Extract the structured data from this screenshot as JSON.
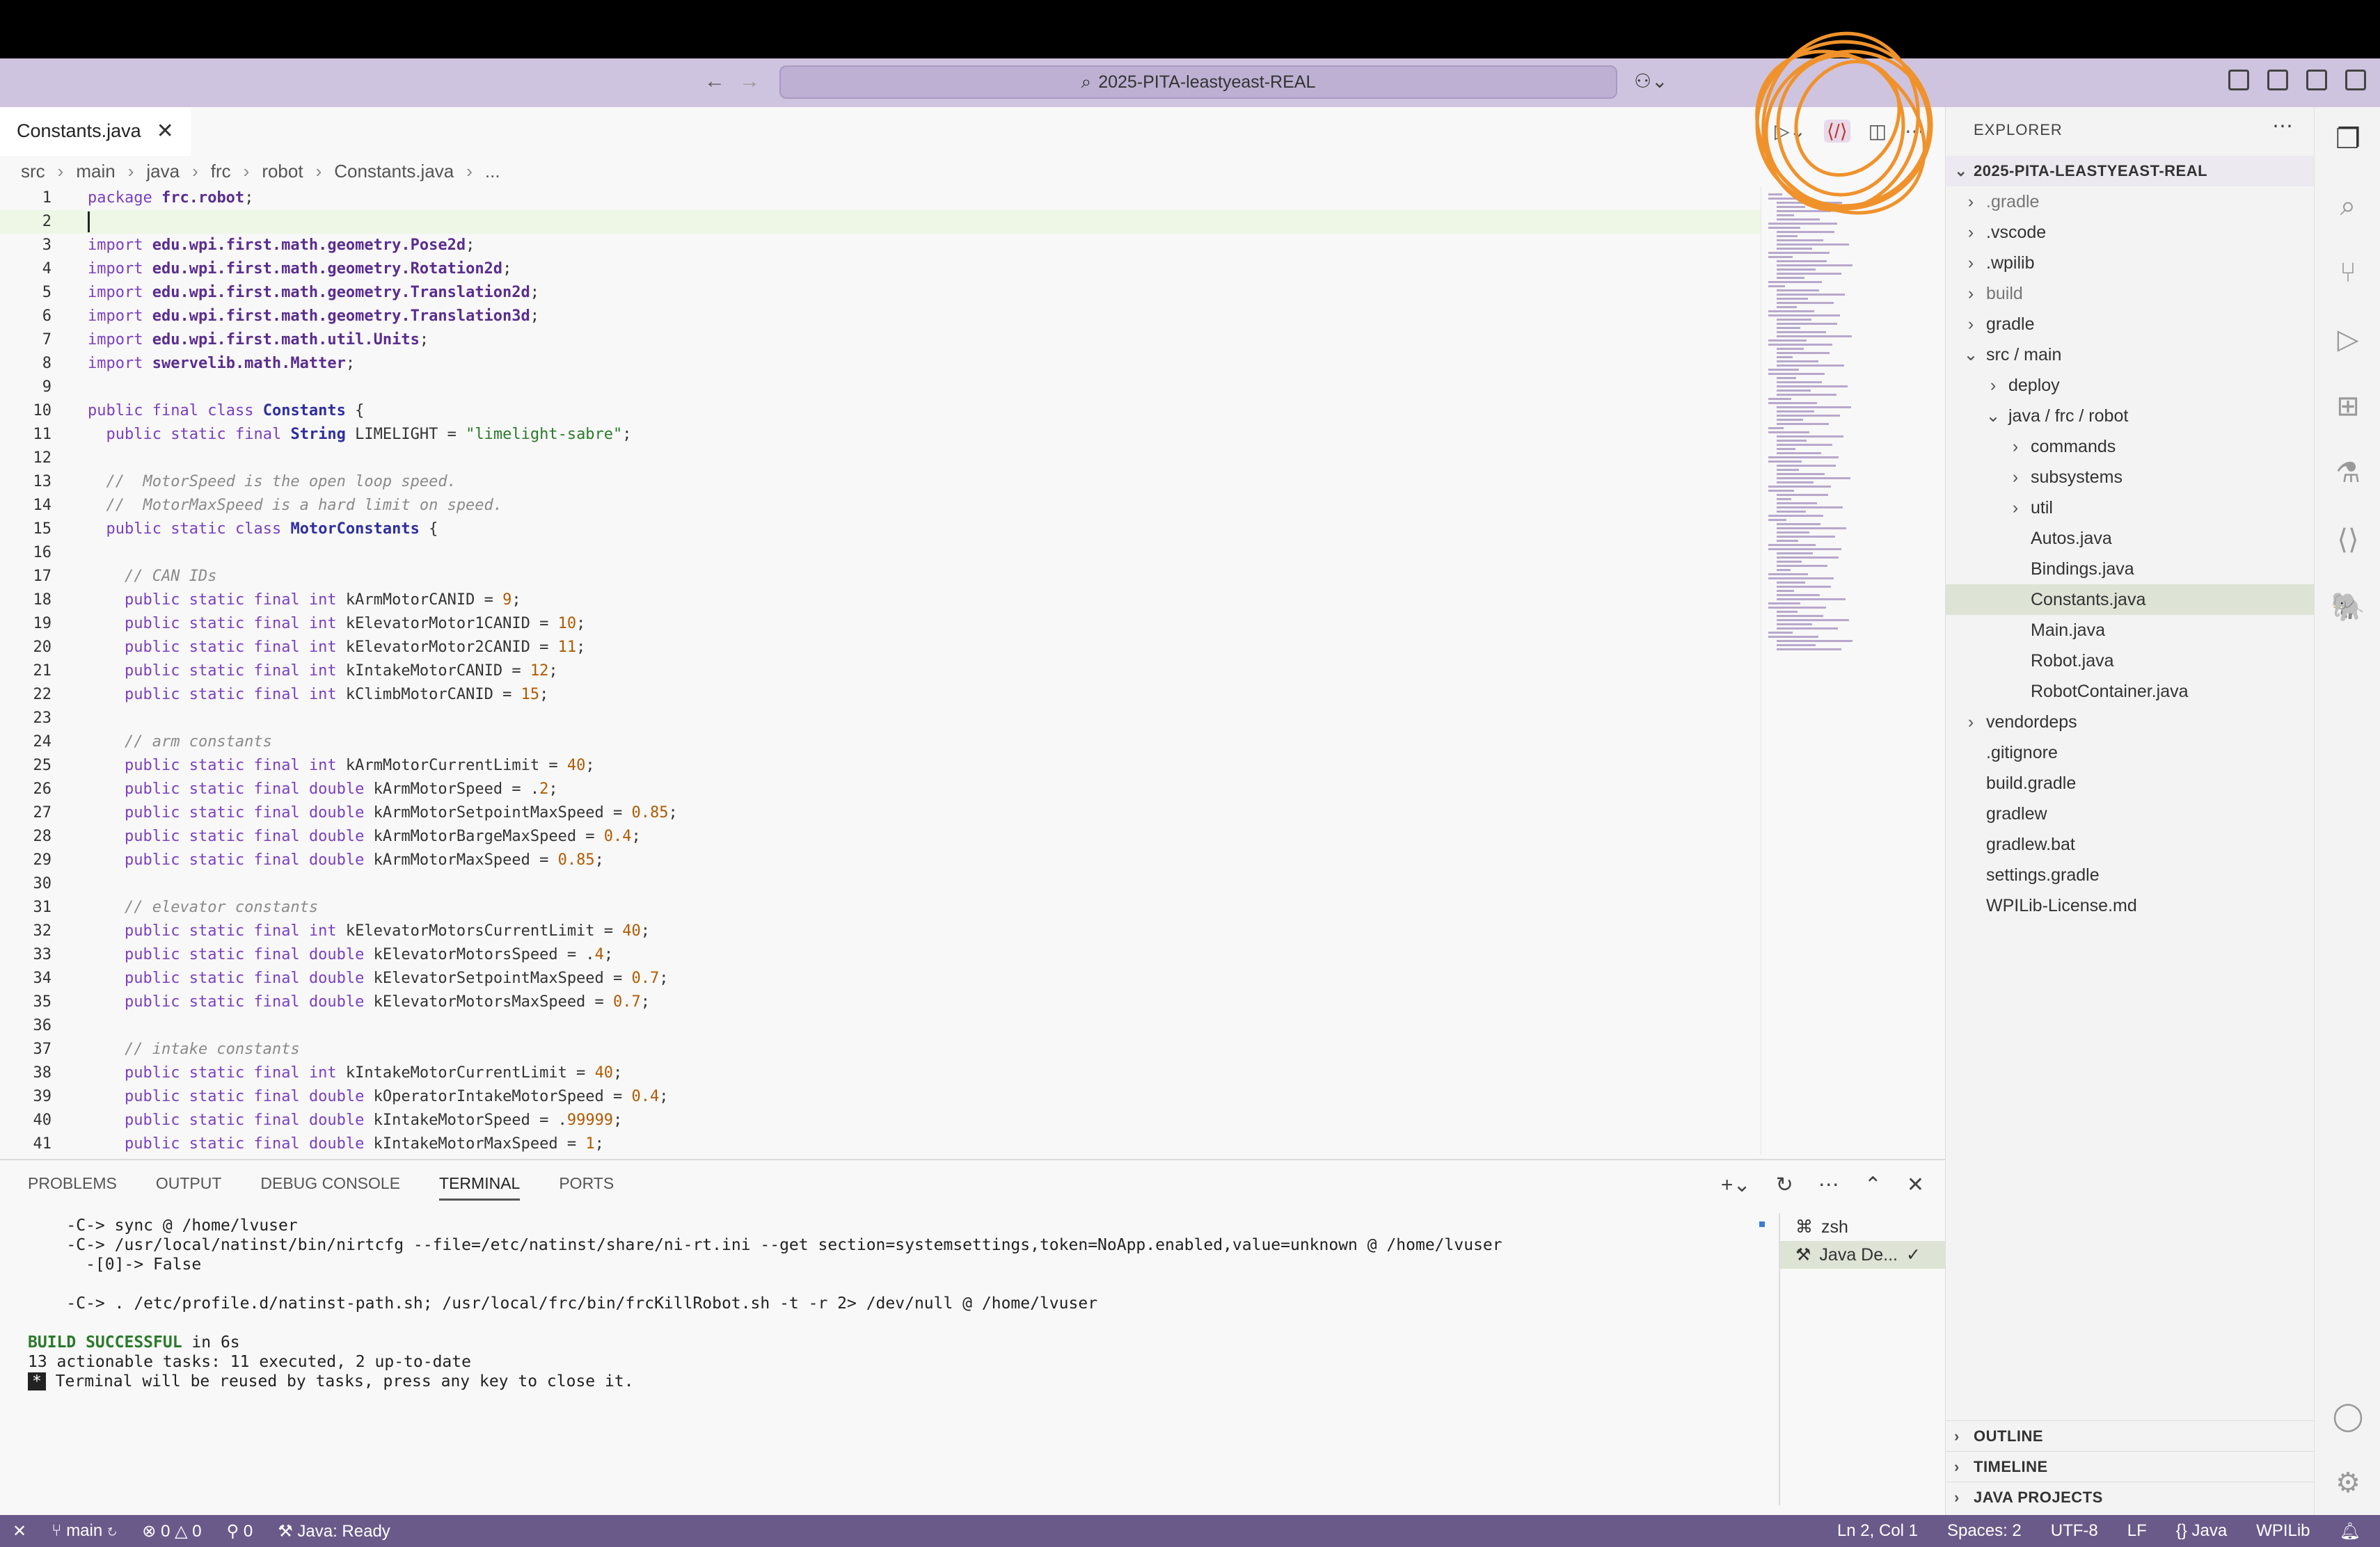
{
  "window": {
    "title": "2025-PITA-leastyeast-REAL"
  },
  "tab": {
    "label": "Constants.java",
    "close": "✕"
  },
  "breadcrumb": [
    "src",
    "main",
    "java",
    "frc",
    "robot",
    "Constants.java",
    "..."
  ],
  "code": [
    {
      "n": "1",
      "t": "package frc.robot;"
    },
    {
      "n": "2",
      "t": ""
    },
    {
      "n": "3",
      "t": "import edu.wpi.first.math.geometry.Pose2d;"
    },
    {
      "n": "4",
      "t": "import edu.wpi.first.math.geometry.Rotation2d;"
    },
    {
      "n": "5",
      "t": "import edu.wpi.first.math.geometry.Translation2d;"
    },
    {
      "n": "6",
      "t": "import edu.wpi.first.math.geometry.Translation3d;"
    },
    {
      "n": "7",
      "t": "import edu.wpi.first.math.util.Units;"
    },
    {
      "n": "8",
      "t": "import swervelib.math.Matter;"
    },
    {
      "n": "9",
      "t": ""
    },
    {
      "n": "10",
      "t": "public final class Constants {"
    },
    {
      "n": "11",
      "t": "  public static final String LIMELIGHT = \"limelight-sabre\";"
    },
    {
      "n": "12",
      "t": ""
    },
    {
      "n": "13",
      "t": "  //  MotorSpeed is the open loop speed."
    },
    {
      "n": "14",
      "t": "  //  MotorMaxSpeed is a hard limit on speed."
    },
    {
      "n": "15",
      "t": "  public static class MotorConstants {"
    },
    {
      "n": "16",
      "t": ""
    },
    {
      "n": "17",
      "t": "    // CAN IDs"
    },
    {
      "n": "18",
      "t": "    public static final int kArmMotorCANID = 9;"
    },
    {
      "n": "19",
      "t": "    public static final int kElevatorMotor1CANID = 10;"
    },
    {
      "n": "20",
      "t": "    public static final int kElevatorMotor2CANID = 11;"
    },
    {
      "n": "21",
      "t": "    public static final int kIntakeMotorCANID = 12;"
    },
    {
      "n": "22",
      "t": "    public static final int kClimbMotorCANID = 15;"
    },
    {
      "n": "23",
      "t": ""
    },
    {
      "n": "24",
      "t": "    // arm constants"
    },
    {
      "n": "25",
      "t": "    public static final int kArmMotorCurrentLimit = 40;"
    },
    {
      "n": "26",
      "t": "    public static final double kArmMotorSpeed = .2;"
    },
    {
      "n": "27",
      "t": "    public static final double kArmMotorSetpointMaxSpeed = 0.85;"
    },
    {
      "n": "28",
      "t": "    public static final double kArmMotorBargeMaxSpeed = 0.4;"
    },
    {
      "n": "29",
      "t": "    public static final double kArmMotorMaxSpeed = 0.85;"
    },
    {
      "n": "30",
      "t": ""
    },
    {
      "n": "31",
      "t": "    // elevator constants"
    },
    {
      "n": "32",
      "t": "    public static final int kElevatorMotorsCurrentLimit = 40;"
    },
    {
      "n": "33",
      "t": "    public static final double kElevatorMotorsSpeed = .4;"
    },
    {
      "n": "34",
      "t": "    public static final double kElevatorSetpointMaxSpeed = 0.7;"
    },
    {
      "n": "35",
      "t": "    public static final double kElevatorMotorsMaxSpeed = 0.7;"
    },
    {
      "n": "36",
      "t": ""
    },
    {
      "n": "37",
      "t": "    // intake constants"
    },
    {
      "n": "38",
      "t": "    public static final int kIntakeMotorCurrentLimit = 40;"
    },
    {
      "n": "39",
      "t": "    public static final double kOperatorIntakeMotorSpeed = 0.4;"
    },
    {
      "n": "40",
      "t": "    public static final double kIntakeMotorSpeed = .99999;"
    },
    {
      "n": "41",
      "t": "    public static final double kIntakeMotorMaxSpeed = 1;"
    }
  ],
  "panel": {
    "tabs": [
      "PROBLEMS",
      "OUTPUT",
      "DEBUG CONSOLE",
      "TERMINAL",
      "PORTS"
    ],
    "active_tab": "TERMINAL",
    "terminal_lines": [
      "    -C-> sync @ /home/lvuser",
      "    -C-> /usr/local/natinst/bin/nirtcfg --file=/etc/natinst/share/ni-rt.ini --get section=systemsettings,token=NoApp.enabled,value=unknown @ /home/lvuser",
      "      -[0]-> False",
      "",
      "    -C-> . /etc/profile.d/natinst-path.sh; /usr/local/frc/bin/frcKillRobot.sh -t -r 2> /dev/null @ /home/lvuser",
      ""
    ],
    "build_status": "BUILD SUCCESSFUL",
    "build_time": " in 6s",
    "tasks_line": "13 actionable tasks: 11 executed, 2 up-to-date",
    "reuse_star": "*",
    "reuse_line": " Terminal will be reused by tasks, press any key to close it.",
    "terminals": [
      {
        "name": "zsh",
        "icon": "terminal-icon"
      },
      {
        "name": "Java De...",
        "icon": "tools-icon",
        "check": "✓"
      }
    ]
  },
  "explorer": {
    "header": "EXPLORER",
    "root": "2025-PITA-LEASTYEAST-REAL",
    "items": [
      {
        "label": ".gradle",
        "depth": 1,
        "folder": true,
        "dim": true
      },
      {
        "label": ".vscode",
        "depth": 1,
        "folder": true
      },
      {
        "label": ".wpilib",
        "depth": 1,
        "folder": true
      },
      {
        "label": "build",
        "depth": 1,
        "folder": true,
        "dim": true
      },
      {
        "label": "gradle",
        "depth": 1,
        "folder": true
      },
      {
        "label": "src / main",
        "depth": 1,
        "folder": true,
        "open": true
      },
      {
        "label": "deploy",
        "depth": 2,
        "folder": true
      },
      {
        "label": "java / frc / robot",
        "depth": 2,
        "folder": true,
        "open": true
      },
      {
        "label": "commands",
        "depth": 3,
        "folder": true
      },
      {
        "label": "subsystems",
        "depth": 3,
        "folder": true
      },
      {
        "label": "util",
        "depth": 3,
        "folder": true
      },
      {
        "label": "Autos.java",
        "depth": 3
      },
      {
        "label": "Bindings.java",
        "depth": 3
      },
      {
        "label": "Constants.java",
        "depth": 3,
        "selected": true
      },
      {
        "label": "Main.java",
        "depth": 3
      },
      {
        "label": "Robot.java",
        "depth": 3
      },
      {
        "label": "RobotContainer.java",
        "depth": 3
      },
      {
        "label": "vendordeps",
        "depth": 1,
        "folder": true
      },
      {
        "label": ".gitignore",
        "depth": 1
      },
      {
        "label": "build.gradle",
        "depth": 1
      },
      {
        "label": "gradlew",
        "depth": 1
      },
      {
        "label": "gradlew.bat",
        "depth": 1
      },
      {
        "label": "settings.gradle",
        "depth": 1
      },
      {
        "label": "WPILib-License.md",
        "depth": 1
      }
    ],
    "sections": [
      "OUTLINE",
      "TIMELINE",
      "JAVA PROJECTS"
    ]
  },
  "status": {
    "branch": "main",
    "errors": "0",
    "warnings": "0",
    "ports": "0",
    "java": "Java: Ready",
    "position": "Ln 2, Col 1",
    "spaces": "Spaces: 2",
    "encoding": "UTF-8",
    "eol": "LF",
    "language": "Java",
    "ext": "WPILib"
  },
  "colors": {
    "accent": "#6a5a8a",
    "titlebar": "#cfc4df",
    "annotation": "#f0922b"
  }
}
